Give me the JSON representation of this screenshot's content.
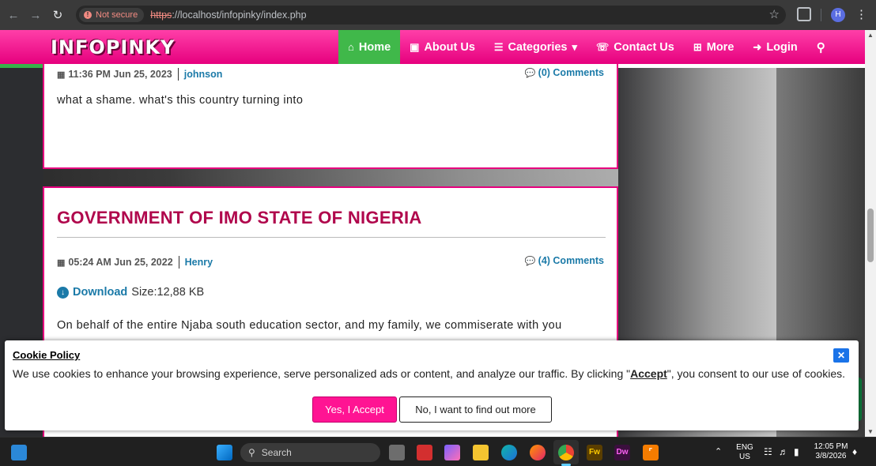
{
  "browser": {
    "security_label": "Not secure",
    "url_scheme": "https",
    "url_rest": "://localhost/infopinky/index.php"
  },
  "site": {
    "logo": "INFOPINKY",
    "menu": [
      {
        "label": "Home",
        "icon": "home-icon"
      },
      {
        "label": "About Us",
        "icon": "id-card-icon"
      },
      {
        "label": "Categories",
        "icon": "list-icon"
      },
      {
        "label": "Contact Us",
        "icon": "phone-icon"
      },
      {
        "label": "More",
        "icon": "plus-icon"
      },
      {
        "label": "Login",
        "icon": "login-icon"
      }
    ],
    "search_icon": "search-icon",
    "read_progress": 0.507
  },
  "post1": {
    "datetime": "11:36 PM Jun 25, 2023",
    "author": "johnson",
    "comments": "(0) Comments",
    "body": "what a shame. what's this country turning into"
  },
  "post2": {
    "title": "GOVERNMENT OF IMO STATE OF NIGERIA",
    "datetime": "05:24 AM Jun 25, 2022",
    "author": "Henry",
    "comments": "(4) Comments",
    "download_label": "Download",
    "size": "Size:12,88 KB",
    "body": "On behalf of the entire Njaba south education sector, and my family, we commiserate with you"
  },
  "cookie": {
    "title": "Cookie Policy",
    "text_before": "We use cookies to enhance your browsing experience, serve personalized ads or content, and analyze our traffic. By clicking \"",
    "accept_word": "Accept",
    "text_after": "\", you consent to our use of cookies.",
    "accept_button": "Yes, I Accept",
    "more_button": "No, I want to find out more",
    "close_symbol": "✕"
  },
  "taskbar": {
    "search_placeholder": "Search",
    "lang_top": "ENG",
    "lang_bottom": "US",
    "time": "12:05 PM",
    "date": "3/8/2026"
  },
  "colors": {
    "brand_pink": "#e6007e",
    "active_green": "#40b84a",
    "link_blue": "#1b7aa8",
    "title_crimson": "#b0064c"
  }
}
